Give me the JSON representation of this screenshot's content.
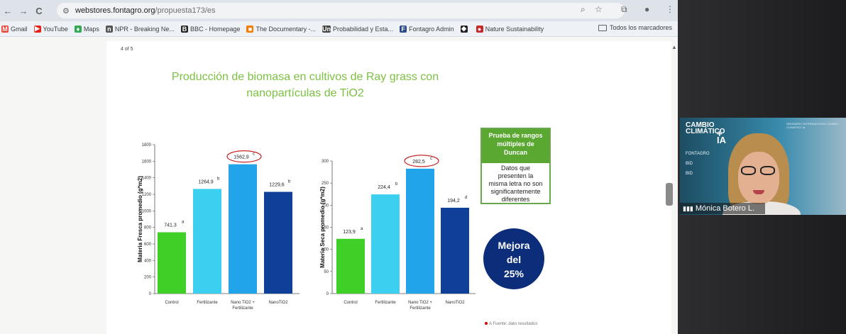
{
  "browser": {
    "url_host": "webstores.fontagro.org",
    "url_path": "/propuesta173/es",
    "nav": {
      "back": "←",
      "forward": "→",
      "reload": "C"
    },
    "toolbar_icons": {
      "zoom": "zoom-icon",
      "star": "star-icon",
      "extension": "puzzle-icon",
      "menu": "kebab-menu-icon"
    }
  },
  "bookmarks": [
    {
      "label": "Gmail",
      "icon": "M",
      "color": "#ea4335"
    },
    {
      "label": "YouTube",
      "icon": "▶",
      "color": "#e62117"
    },
    {
      "label": "Maps",
      "icon": "♦",
      "color": "#34a853"
    },
    {
      "label": "NPR - Breaking Ne...",
      "icon": "n",
      "color": "#555555"
    },
    {
      "label": "BBC - Homepage",
      "icon": "B",
      "color": "#222222"
    },
    {
      "label": "The Documentary -...",
      "icon": "■",
      "color": "#f57c00"
    },
    {
      "label": "Probabilidad y Esta...",
      "icon": "Un",
      "color": "#444444"
    },
    {
      "label": "Fontagro Admin",
      "icon": "F",
      "color": "#2b4a8a"
    },
    {
      "label": "",
      "icon": "◆",
      "color": "#222222"
    },
    {
      "label": "Nature Sustainability",
      "icon": "●",
      "color": "#c62828"
    }
  ],
  "bookmarks_all": "Todos los marcadores",
  "page": {
    "counter": "4 of 5",
    "title_line1": "Producción de biomasa en cultivos de Ray grass con",
    "title_line2": "nanopartículas de TiO2",
    "legend_head": [
      "Prueba de rangos",
      "múltiples de",
      "Duncan"
    ],
    "legend_body": [
      "Datos que",
      "presenten la",
      "misma letra no son",
      "significantemente",
      "diferentes"
    ],
    "mejora": [
      "Mejora",
      "del",
      "25%"
    ],
    "footnote": "A Fuente: dato resultados"
  },
  "chart_data": [
    {
      "type": "bar",
      "ylabel": "Materia Fresca promedio (g*m2)",
      "categories": [
        "Control",
        "Fertilizante",
        "Nano TiO2 + Fertilizante",
        "NanoTiO2"
      ],
      "values": [
        741.3,
        1264.9,
        1562.9,
        1229.6
      ],
      "value_labels": [
        "741,3",
        "1264,9",
        "1562,9",
        "1229,6"
      ],
      "letters": [
        "a",
        "b",
        "c",
        "b"
      ],
      "circled": 2,
      "ylim": [
        0,
        1800
      ],
      "yticks": [
        0,
        200,
        400,
        600,
        800,
        1000,
        1200,
        1400,
        1600,
        1800
      ],
      "colors": [
        "#3fd027",
        "#3bcff0",
        "#22a4ea",
        "#103f99"
      ]
    },
    {
      "type": "bar",
      "ylabel": "Materia Seca promedio (g*m2)",
      "categories": [
        "Control",
        "Fertilizante",
        "Nano TiO2 + Fertilizante",
        "NanoTiO2"
      ],
      "values": [
        123.9,
        224.4,
        282.5,
        194.2
      ],
      "value_labels": [
        "123,9",
        "224,4",
        "282,5",
        "194,2"
      ],
      "letters": [
        "a",
        "b",
        "c",
        "d"
      ],
      "circled": 2,
      "ylim": [
        0,
        300
      ],
      "yticks": [
        0,
        50,
        100,
        150,
        200,
        250,
        300
      ],
      "colors": [
        "#3fd027",
        "#3bcff0",
        "#22a4ea",
        "#103f99"
      ]
    }
  ],
  "video": {
    "logo_top": "CAMBIO",
    "logo_bottom": "CLIMÁTICO",
    "logo_suffix": "+ IA",
    "lines": [
      "FONTAGRO",
      "BID",
      "BID"
    ],
    "banner": "SEMINARIO INTERNACIONAL CAMBIO CLIMATICO IA",
    "participant_name": "Mónica Botero L."
  }
}
